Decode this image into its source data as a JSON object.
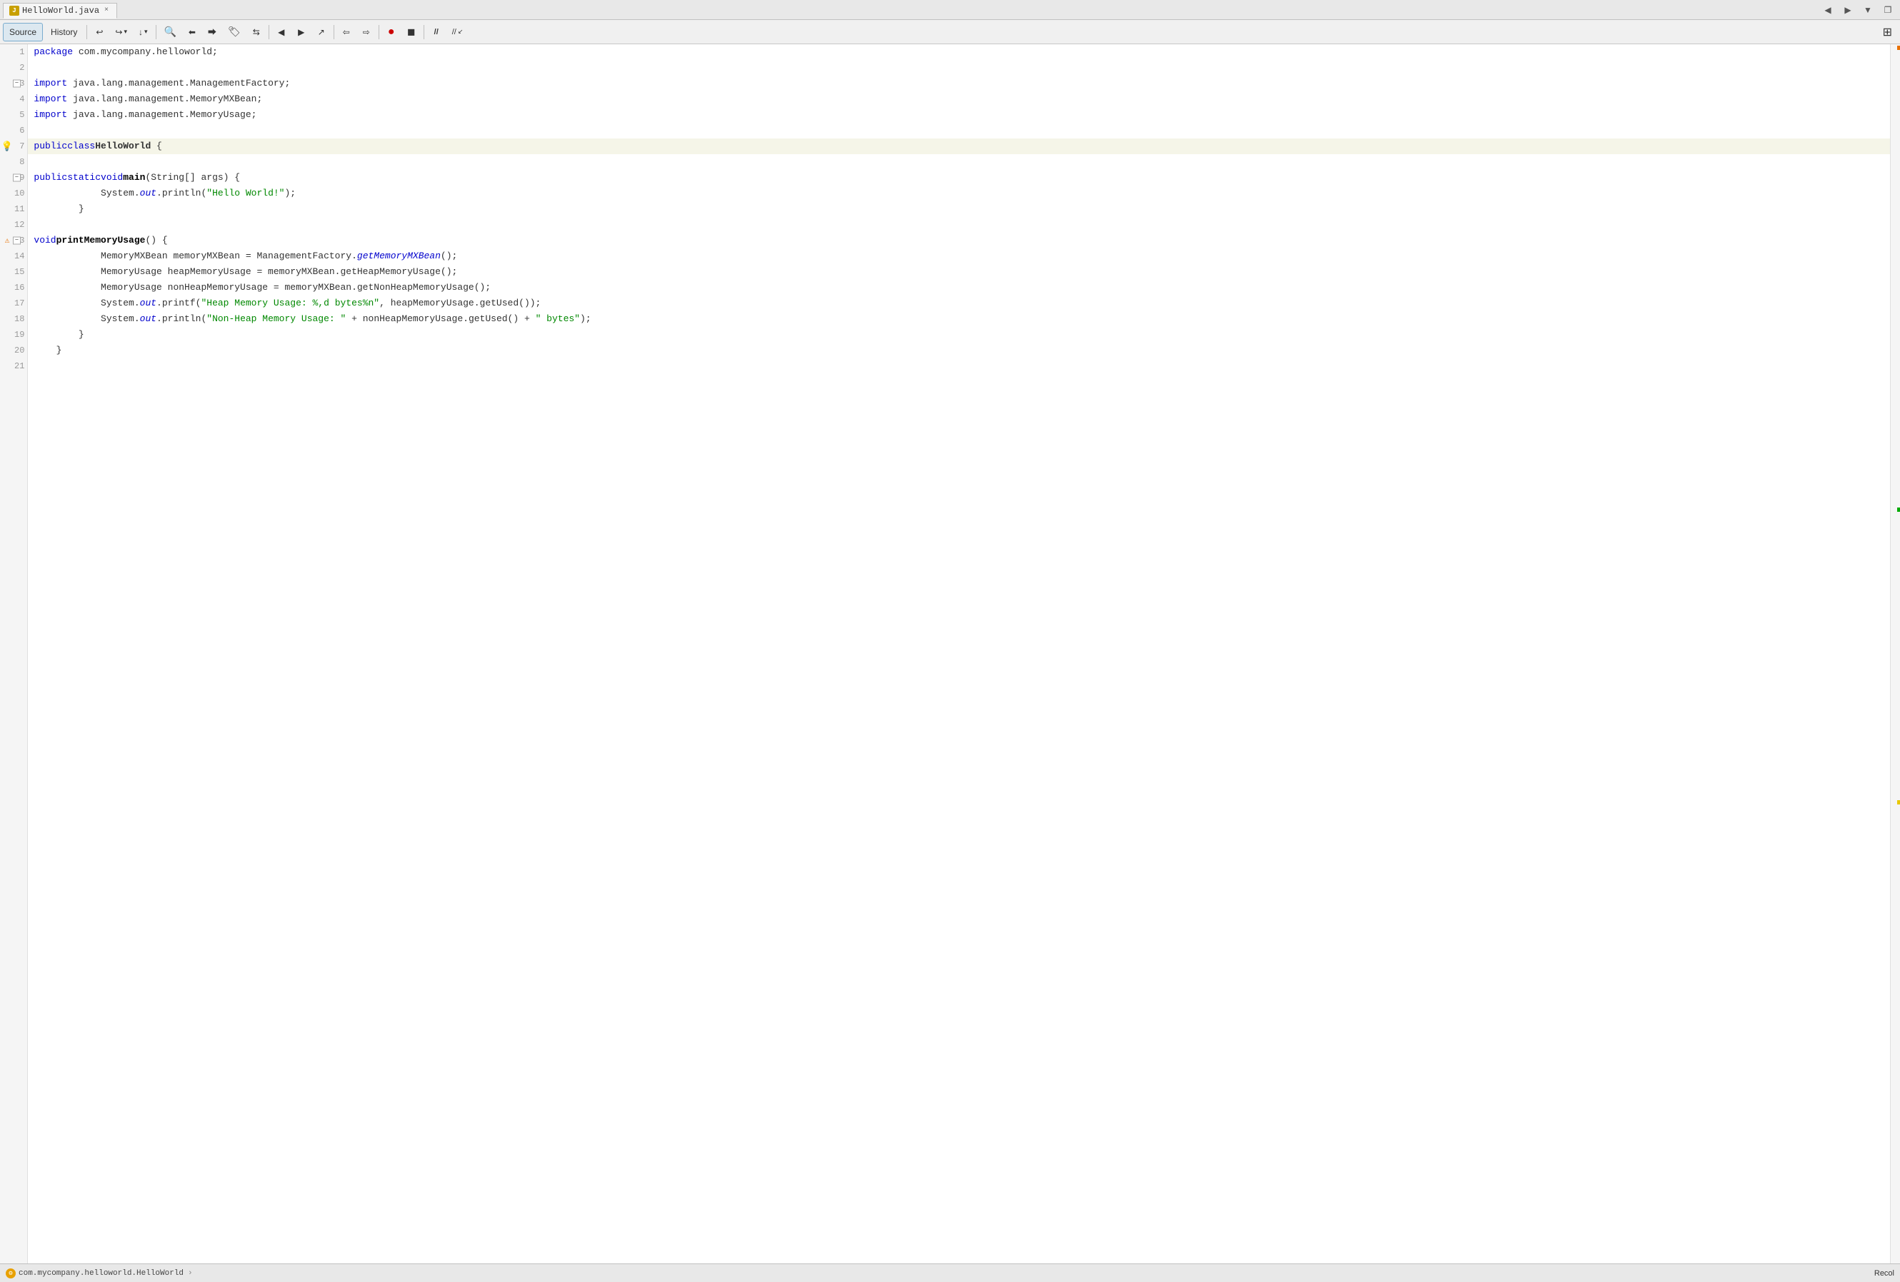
{
  "titlebar": {
    "tab_label": "HelloWorld.java",
    "tab_icon": "J",
    "nav_back": "◀",
    "nav_forward": "▶",
    "nav_down": "▼",
    "nav_restore": "❐"
  },
  "toolbar": {
    "source_label": "Source",
    "history_label": "History",
    "buttons": [
      {
        "name": "back-btn",
        "label": "↩",
        "title": "Back"
      },
      {
        "name": "forward-history-btn",
        "label": "↪▾",
        "title": "Forward"
      },
      {
        "name": "down-btn",
        "label": "↓▾",
        "title": "Down"
      },
      {
        "name": "search-btn",
        "label": "🔍",
        "title": "Search"
      },
      {
        "name": "previous-bookmark-btn",
        "label": "⇐",
        "title": "Previous"
      },
      {
        "name": "next-bookmark-btn",
        "label": "⇒",
        "title": "Next"
      },
      {
        "name": "bookmark-btn",
        "label": "🏷",
        "title": "Bookmark"
      },
      {
        "name": "toggle-btn",
        "label": "⇆",
        "title": "Toggle"
      },
      {
        "name": "prev-btn2",
        "label": "←",
        "title": "Prev"
      },
      {
        "name": "next-btn2",
        "label": "→",
        "title": "Next"
      },
      {
        "name": "out-btn",
        "label": "↗",
        "title": "Out"
      },
      {
        "name": "diff-prev-btn",
        "label": "⇦",
        "title": "Diff Prev"
      },
      {
        "name": "diff-next-btn",
        "label": "⇨",
        "title": "Diff Next"
      },
      {
        "name": "record-btn",
        "label": "●",
        "title": "Record"
      },
      {
        "name": "stop-btn",
        "label": "◼",
        "title": "Stop"
      },
      {
        "name": "comment-btn",
        "label": "//",
        "title": "Comment"
      },
      {
        "name": "uncomment-btn",
        "label": "//⃥",
        "title": "Uncomment"
      },
      {
        "name": "grid-btn",
        "label": "⊞",
        "title": "Grid"
      }
    ]
  },
  "code": {
    "lines": [
      {
        "num": 1,
        "indent": 0,
        "content": "    package com.mycompany.helloworld;",
        "highlighted": false,
        "foldable": false,
        "icon": null
      },
      {
        "num": 2,
        "indent": 0,
        "content": "",
        "highlighted": false,
        "foldable": false,
        "icon": null
      },
      {
        "num": 3,
        "indent": 0,
        "content": "    import java.lang.management.ManagementFactory;",
        "highlighted": false,
        "foldable": true,
        "icon": null
      },
      {
        "num": 4,
        "indent": 0,
        "content": "    import java.lang.management.MemoryMXBean;",
        "highlighted": false,
        "foldable": false,
        "icon": null
      },
      {
        "num": 5,
        "indent": 0,
        "content": "    import java.lang.management.MemoryUsage;",
        "highlighted": false,
        "foldable": false,
        "icon": null
      },
      {
        "num": 6,
        "indent": 0,
        "content": "",
        "highlighted": false,
        "foldable": false,
        "icon": null
      },
      {
        "num": 7,
        "indent": 0,
        "content": "    public class HelloWorld {",
        "highlighted": true,
        "foldable": false,
        "icon": "bulb"
      },
      {
        "num": 8,
        "indent": 0,
        "content": "",
        "highlighted": false,
        "foldable": false,
        "icon": null
      },
      {
        "num": 9,
        "indent": 1,
        "content": "        public static void main(String[] args) {",
        "highlighted": false,
        "foldable": true,
        "icon": null
      },
      {
        "num": 10,
        "indent": 2,
        "content": "            System.out.println(\"Hello World!\");",
        "highlighted": false,
        "foldable": false,
        "icon": null
      },
      {
        "num": 11,
        "indent": 1,
        "content": "        }",
        "highlighted": false,
        "foldable": false,
        "icon": null
      },
      {
        "num": 12,
        "indent": 0,
        "content": "",
        "highlighted": false,
        "foldable": false,
        "icon": null
      },
      {
        "num": 13,
        "indent": 1,
        "content": "        void printMemoryUsage() {",
        "highlighted": false,
        "foldable": true,
        "icon": "warning"
      },
      {
        "num": 14,
        "indent": 2,
        "content": "            MemoryMXBean memoryMXBean = ManagementFactory.getMemoryMXBean();",
        "highlighted": false,
        "foldable": false,
        "icon": null
      },
      {
        "num": 15,
        "indent": 2,
        "content": "            MemoryUsage heapMemoryUsage = memoryMXBean.getHeapMemoryUsage();",
        "highlighted": false,
        "foldable": false,
        "icon": null
      },
      {
        "num": 16,
        "indent": 2,
        "content": "            MemoryUsage nonHeapMemoryUsage = memoryMXBean.getNonHeapMemoryUsage();",
        "highlighted": false,
        "foldable": false,
        "icon": null
      },
      {
        "num": 17,
        "indent": 2,
        "content": "            System.out.printf(\"Heap Memory Usage: %,d bytes%n\", heapMemoryUsage.getUsed());",
        "highlighted": false,
        "foldable": false,
        "icon": null
      },
      {
        "num": 18,
        "indent": 2,
        "content": "            System.out.println(\"Non-Heap Memory Usage: \" + nonHeapMemoryUsage.getUsed() + \" bytes\");",
        "highlighted": false,
        "foldable": false,
        "icon": null
      },
      {
        "num": 19,
        "indent": 1,
        "content": "        }",
        "highlighted": false,
        "foldable": false,
        "icon": null
      },
      {
        "num": 20,
        "indent": 0,
        "content": "    }",
        "highlighted": false,
        "foldable": false,
        "icon": null
      },
      {
        "num": 21,
        "indent": 0,
        "content": "",
        "highlighted": false,
        "foldable": false,
        "icon": null
      }
    ]
  },
  "statusbar": {
    "icon": "⚙",
    "path": "com.mycompany.helloworld.HelloWorld",
    "arrow": "›",
    "recoil_label": "Recol"
  },
  "colors": {
    "keyword": "#0000cc",
    "string": "#008800",
    "italic": "#0000cc",
    "highlight_bg": "#f5f5e8",
    "accent_green": "#00aa00",
    "accent_yellow": "#e8a000",
    "accent_orange": "#e8a000"
  }
}
